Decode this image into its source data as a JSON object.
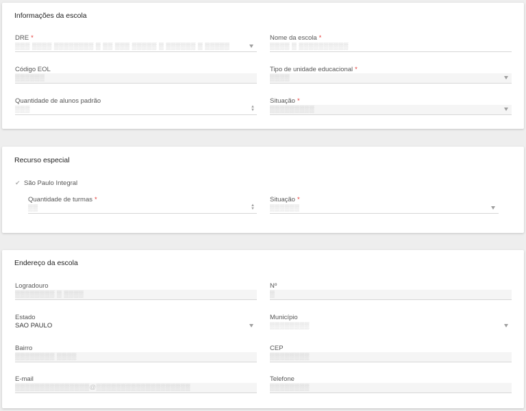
{
  "school_info": {
    "title": "Informações da escola",
    "dre": {
      "label": "DRE",
      "value": "▒▒▒ ▒▒▒▒ ▒▒▒▒▒▒▒▒ ▒ ▒▒ ▒▒▒ ▒▒▒▒▒ ▒ ▒▒▒▒▒▒ ▒ ▒▒▒▒▒"
    },
    "nome_escola": {
      "label": "Nome da escola",
      "value": "▒▒▒▒ ▒ ▒▒▒▒▒▒▒▒▒▒"
    },
    "codigo_eol": {
      "label": "Código EOL",
      "value": "▒▒▒▒▒▒"
    },
    "tipo_unidade": {
      "label": "Tipo de unidade educacional",
      "value": "▒▒▒▒"
    },
    "qtd_alunos": {
      "label": "Quantidade de alunos padrão",
      "value": "▒▒▒"
    },
    "situacao": {
      "label": "Situação",
      "value": "▒▒▒▒▒▒▒▒▒"
    }
  },
  "special_resource": {
    "title": "Recurso especial",
    "checkbox_label": "São Paulo Integral",
    "qtd_turmas": {
      "label": "Quantidade de turmas",
      "value": "▒▒"
    },
    "situacao": {
      "label": "Situação",
      "value": "▒▒▒▒▒▒"
    }
  },
  "address": {
    "title": "Endereço da escola",
    "logradouro": {
      "label": "Logradouro",
      "value": "▒▒▒▒▒▒▒▒ ▒ ▒▒▒▒"
    },
    "numero": {
      "label": "Nº",
      "value": "▒"
    },
    "estado": {
      "label": "Estado",
      "value": "SAO PAULO"
    },
    "municipio": {
      "label": "Município",
      "value": "▒▒▒▒▒▒▒▒"
    },
    "bairro": {
      "label": "Bairro",
      "value": "▒▒▒▒▒▒▒▒ ▒▒▒▒"
    },
    "cep": {
      "label": "CEP",
      "value": "▒▒▒▒▒▒▒▒"
    },
    "email": {
      "label": "E-mail",
      "value": "▒▒▒▒▒▒▒▒▒▒▒▒▒▒▒@▒▒▒▒▒▒▒▒▒▒▒▒▒▒▒▒▒▒▒"
    },
    "telefone": {
      "label": "Telefone",
      "value": "▒▒▒▒▒▒▒▒"
    }
  },
  "required_marker": "*",
  "colors": {
    "required": "#e53935",
    "background": "#eeeeee",
    "card": "#ffffff"
  }
}
